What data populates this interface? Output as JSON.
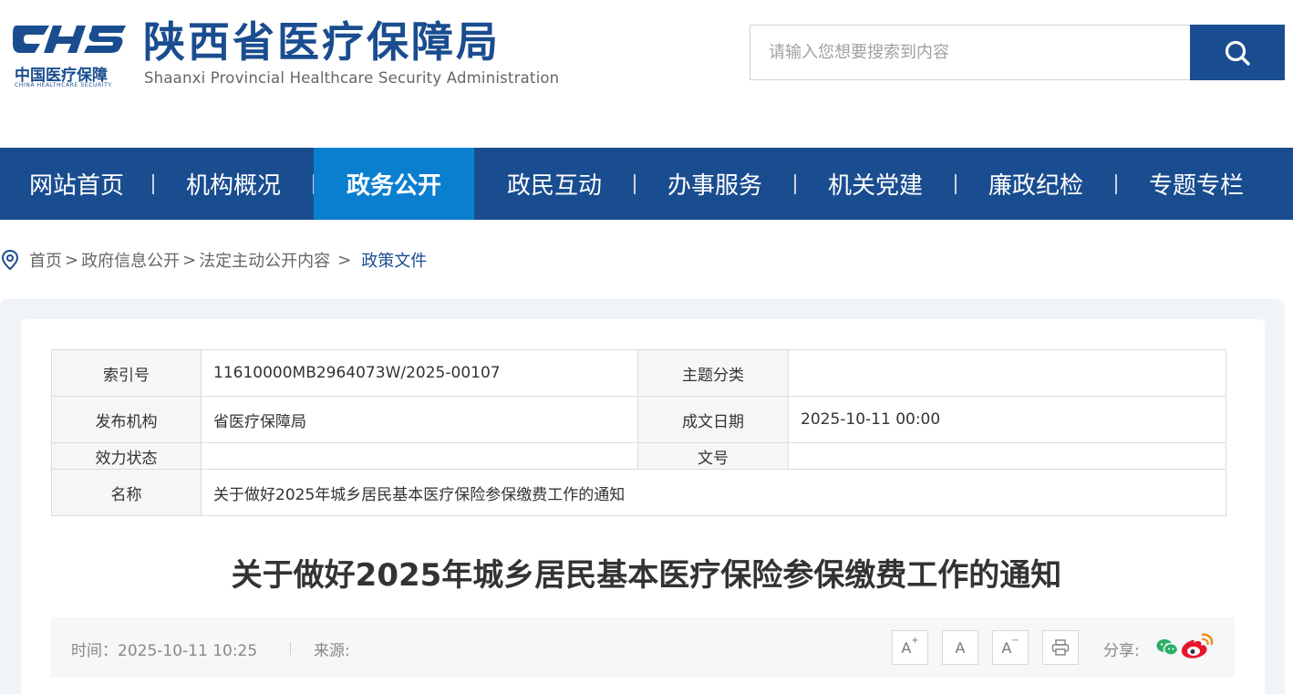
{
  "header": {
    "logo_mark": "CHS",
    "logo_cn": "中国医疗保障",
    "logo_en": "CHINA HEALTHCARE SECURITY",
    "title_cn": "陕西省医疗保障局",
    "title_en": "Shaanxi Provincial Healthcare Security Administration"
  },
  "search": {
    "placeholder": "请输入您想要搜索到内容"
  },
  "nav": {
    "items": [
      {
        "label": "网站首页"
      },
      {
        "label": "机构概况"
      },
      {
        "label": "政务公开"
      },
      {
        "label": "政民互动"
      },
      {
        "label": "办事服务"
      },
      {
        "label": "机关党建"
      },
      {
        "label": "廉政纪检"
      },
      {
        "label": "专题专栏"
      }
    ]
  },
  "breadcrumb": {
    "items": [
      "首页",
      "政府信息公开",
      "法定主动公开内容"
    ],
    "separator": ">",
    "current": "政策文件"
  },
  "meta": {
    "index_label": "索引号",
    "index_value": "11610000MB2964073W/2025-00107",
    "topic_label": "主题分类",
    "topic_value": "",
    "issuer_label": "发布机构",
    "issuer_value": "省医疗保障局",
    "date_label": "成文日期",
    "date_value": "2025-10-11 00:00",
    "status_label": "效力状态",
    "status_value": "",
    "docno_label": "文号",
    "docno_value": "",
    "name_label": "名称",
    "name_value": "关于做好2025年城乡居民基本医疗保险参保缴费工作的通知"
  },
  "article": {
    "title": "关于做好2025年城乡居民基本医疗保险参保缴费工作的通知",
    "time_text": "时间：2025-10-11 10:25",
    "source_text": "来源:",
    "font_increase": "A",
    "font_increase_mark": "+",
    "font_normal": "A",
    "font_decrease": "A",
    "font_decrease_mark": "−",
    "share_label": "分享:"
  },
  "colors": {
    "brand_blue": "#1a4d8f",
    "nav_active": "#0b7fcf",
    "wechat_green": "#2aae67",
    "weibo_red": "#e6162d"
  }
}
